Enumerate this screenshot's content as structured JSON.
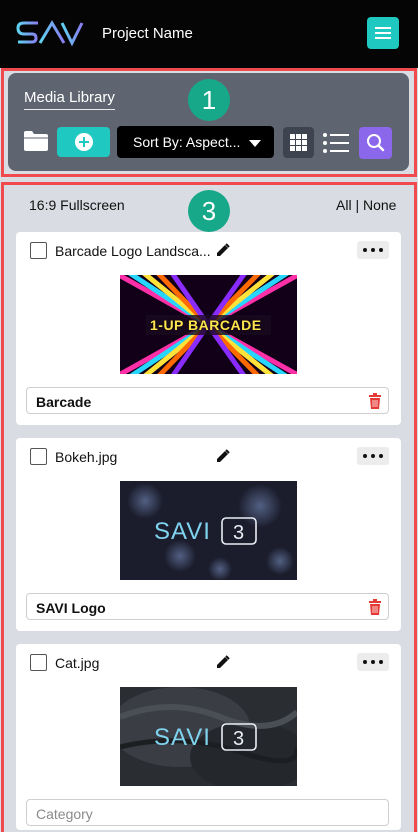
{
  "header": {
    "logo_text": "SAVI",
    "project_name": "Project Name",
    "menu_icon": "hamburger-icon"
  },
  "library": {
    "badge": "1",
    "title": "Media Library",
    "folder_icon": "folder-icon",
    "add_icon": "plus-circle-icon",
    "sort_label": "Sort By: Aspect...",
    "grid_icon": "grid-view-icon",
    "list_icon": "list-view-icon",
    "search_icon": "search-icon"
  },
  "media": {
    "badge": "3",
    "section_label": "16:9 Fullscreen",
    "select_all": "All",
    "separator": " | ",
    "select_none": "None",
    "items": [
      {
        "file_name": "Barcade Logo Landsca...",
        "thumbnail_text": "1-UP BARCADE",
        "category_value": "Barcade"
      },
      {
        "file_name": "Bokeh.jpg",
        "thumbnail_text": "SAVI 3",
        "category_value": "SAVI Logo"
      },
      {
        "file_name": "Cat.jpg",
        "thumbnail_text": "SAVI 3",
        "category_placeholder": "Category"
      }
    ]
  },
  "colors": {
    "teal_accent": "#20c8c2",
    "badge_green": "#17a889",
    "search_purple": "#8b67ec",
    "outline_red": "#f14a4e",
    "panel_gray": "#5f6570",
    "trash_red": "#e53935"
  }
}
